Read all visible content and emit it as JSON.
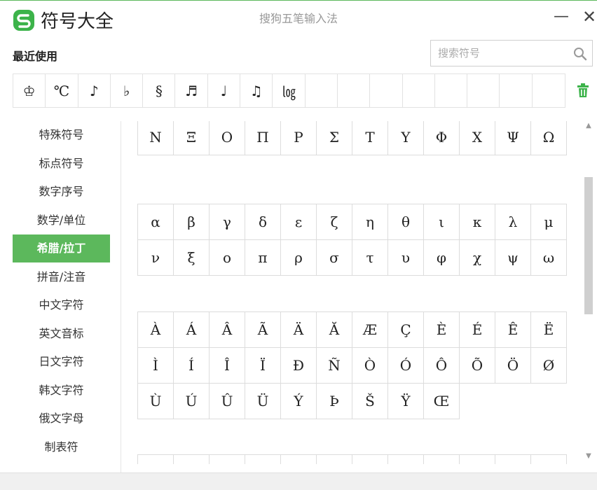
{
  "window": {
    "title": "符号大全",
    "ime_name": "搜狗五笔输入法",
    "minimize_glyph": "—",
    "close_glyph": "✕",
    "accent_color": "#5cb85c"
  },
  "recent": {
    "label": "最近使用",
    "items": [
      "♔",
      "℃",
      "♪",
      "♭",
      "§",
      "♬",
      "♩",
      "♫",
      "㏒",
      "",
      "",
      "",
      "",
      "",
      "",
      "",
      ""
    ]
  },
  "search": {
    "placeholder": "搜索符号",
    "value": ""
  },
  "sidebar": {
    "items": [
      {
        "label": "特殊符号",
        "active": false
      },
      {
        "label": "标点符号",
        "active": false
      },
      {
        "label": "数字序号",
        "active": false
      },
      {
        "label": "数学/单位",
        "active": false
      },
      {
        "label": "希腊/拉丁",
        "active": true
      },
      {
        "label": "拼音/注音",
        "active": false
      },
      {
        "label": "中文字符",
        "active": false
      },
      {
        "label": "英文音标",
        "active": false
      },
      {
        "label": "日文字符",
        "active": false
      },
      {
        "label": "韩文字符",
        "active": false
      },
      {
        "label": "俄文字母",
        "active": false
      },
      {
        "label": "制表符",
        "active": false
      }
    ]
  },
  "groups": [
    {
      "symbols": [
        "Ν",
        "Ξ",
        "Ο",
        "Π",
        "Ρ",
        "Σ",
        "Τ",
        "Υ",
        "Φ",
        "Χ",
        "Ψ",
        "Ω"
      ]
    },
    {
      "symbols": [
        "α",
        "β",
        "γ",
        "δ",
        "ε",
        "ζ",
        "η",
        "θ",
        "ι",
        "κ",
        "λ",
        "μ",
        "ν",
        "ξ",
        "ο",
        "π",
        "ρ",
        "σ",
        "τ",
        "υ",
        "φ",
        "χ",
        "ψ",
        "ω"
      ]
    },
    {
      "symbols": [
        "À",
        "Á",
        "Â",
        "Ã",
        "Ä",
        "Ă",
        "Æ",
        "Ç",
        "È",
        "É",
        "Ê",
        "Ë",
        "Ì",
        "Í",
        "Î",
        "Ï",
        "Ð",
        "Ñ",
        "Ò",
        "Ó",
        "Ô",
        "Õ",
        "Ö",
        "Ø",
        "Ù",
        "Ú",
        "Û",
        "Ü",
        "Ý",
        "Þ",
        "Š",
        "Ÿ",
        "Œ"
      ]
    },
    {
      "symbols": [
        "",
        "",
        "",
        "",
        "",
        "",
        "",
        "",
        "",
        "",
        "",
        ""
      ]
    }
  ],
  "icons": {
    "logo": "sogou-logo-icon",
    "search": "search-icon",
    "trash": "trash-icon"
  }
}
